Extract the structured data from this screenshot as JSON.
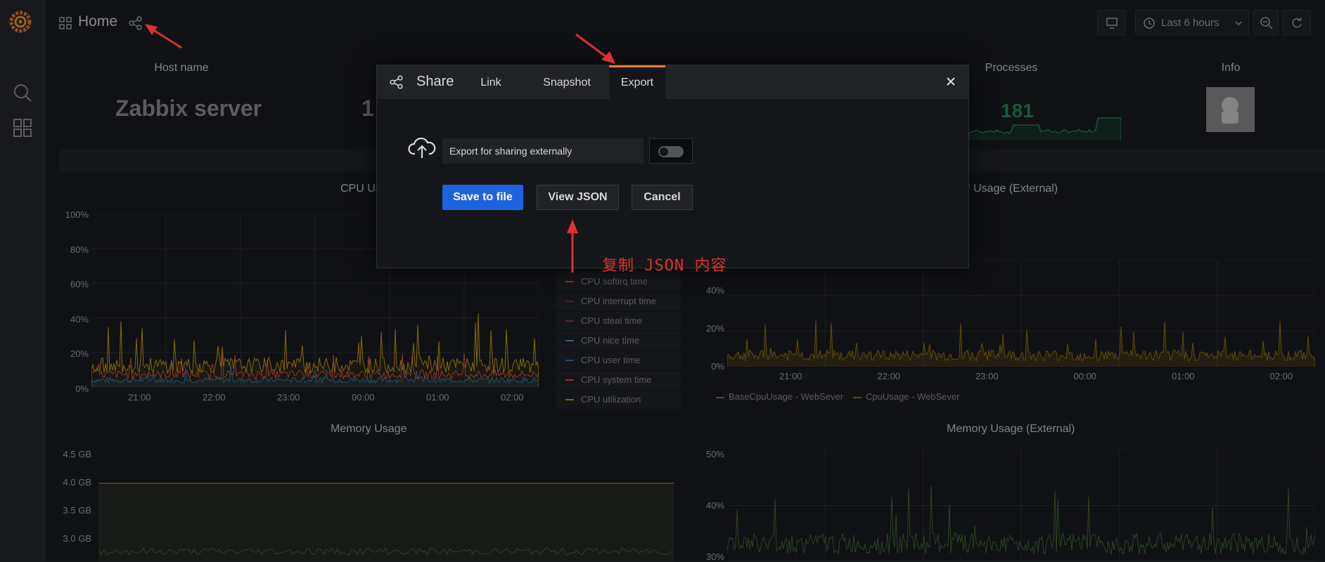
{
  "topbar": {
    "title": "Home",
    "time_range": "Last 6 hours"
  },
  "stats": {
    "host_name_label": "Host name",
    "host_name_value": "Zabbix server",
    "partial_value": "1",
    "processes_label": "Processes",
    "processes_value": "181",
    "info_label": "Info"
  },
  "cpu_panel": {
    "title_partial": "CPU Us",
    "y_ticks": [
      "100%",
      "80%",
      "60%",
      "40%",
      "20%",
      "0%"
    ],
    "x_ticks": [
      "21:00",
      "22:00",
      "23:00",
      "00:00",
      "01:00",
      "02:00"
    ],
    "legend": [
      {
        "label": "CPU softirq time",
        "color": "#e24d42"
      },
      {
        "label": "CPU interrupt time",
        "color": "#bf1b00"
      },
      {
        "label": "CPU steal time",
        "color": "#962d82"
      },
      {
        "label": "CPU nice time",
        "color": "#5195ce"
      },
      {
        "label": "CPU user time",
        "color": "#1f78c1"
      },
      {
        "label": "CPU system time",
        "color": "#e24d42"
      },
      {
        "label": "CPU utilization",
        "color": "#cca300"
      }
    ]
  },
  "cpu_ext_panel": {
    "title_partial": "U Usage (External)",
    "y_ticks": [
      "40%",
      "20%",
      "0%"
    ],
    "x_ticks": [
      "21:00",
      "22:00",
      "23:00",
      "00:00",
      "01:00",
      "02:00"
    ],
    "legend": [
      {
        "label": "BaseCpuUsage - WebSever",
        "color": "#6d6d6d"
      },
      {
        "label": "CpuUsage - WebSever",
        "color": "#967302"
      }
    ]
  },
  "memory_panel": {
    "title": "Memory Usage",
    "y_ticks": [
      "4.5 GB",
      "4.0 GB",
      "3.5 GB",
      "3.0 GB"
    ]
  },
  "memory_ext_panel": {
    "title": "Memory Usage (External)",
    "y_ticks": [
      "50%",
      "40%",
      "30%"
    ]
  },
  "modal": {
    "title": "Share",
    "tabs": [
      {
        "label": "Link"
      },
      {
        "label": "Snapshot"
      },
      {
        "label": "Export"
      }
    ],
    "active_tab": "Export",
    "export_label": "Export for sharing externally",
    "toggle_on": false,
    "save_button": "Save to file",
    "view_json_button": "View JSON",
    "cancel_button": "Cancel"
  },
  "annotation": {
    "text": "复制 JSON 内容"
  },
  "colors": {
    "accent_orange": "#eb7b18",
    "primary_blue": "#1f62e0",
    "annotation_red": "#e02f2f",
    "stat_green": "#1f8a4c"
  }
}
